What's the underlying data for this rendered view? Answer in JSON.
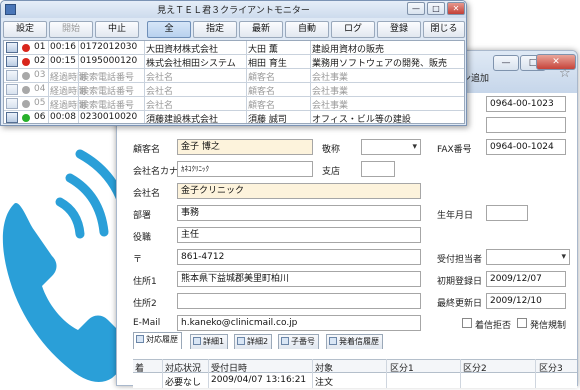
{
  "monitor": {
    "title": "見えＴＥＬ君３クライアントモニター",
    "controls": {
      "minimize": "—",
      "maximize": "□",
      "close": "✕"
    },
    "toolbar": [
      {
        "label": "設定",
        "state": "normal"
      },
      {
        "label": "開始",
        "state": "disabled"
      },
      {
        "label": "中止",
        "state": "normal"
      },
      {
        "label": "全",
        "state": "pressed"
      },
      {
        "label": "指定",
        "state": "normal"
      },
      {
        "label": "最新",
        "state": "normal"
      },
      {
        "label": "自動",
        "state": "normal"
      },
      {
        "label": "ログ",
        "state": "normal"
      },
      {
        "label": "登録",
        "state": "normal"
      },
      {
        "label": "閉じる",
        "state": "normal"
      }
    ],
    "rows": [
      {
        "num": "01",
        "time": "00:16",
        "phone": "0172012030",
        "company": "大田資材株式会社",
        "person": "大田 薫",
        "business": "建設用資材の販売",
        "status": "red",
        "active": true
      },
      {
        "num": "02",
        "time": "00:15",
        "phone": "0195000120",
        "company": "株式会社相田システム",
        "person": "相田 育生",
        "business": "業務用ソフトウェアの開発、販売",
        "status": "red",
        "active": true
      },
      {
        "num": "03",
        "time": "経過時間",
        "phone": "検索電話番号",
        "company": "会社名",
        "person": "顧客名",
        "business": "会社事業",
        "status": "gray",
        "active": false
      },
      {
        "num": "04",
        "time": "経過時間",
        "phone": "検索電話番号",
        "company": "会社名",
        "person": "顧客名",
        "business": "会社事業",
        "status": "gray",
        "active": false
      },
      {
        "num": "05",
        "time": "経過時間",
        "phone": "検索電話番号",
        "company": "会社名",
        "person": "顧客名",
        "business": "会社事業",
        "status": "gray",
        "active": false
      },
      {
        "num": "06",
        "time": "00:08",
        "phone": "0230010020",
        "company": "須藤建設株式会社",
        "person": "須藤 誠司",
        "business": "オフィス・ビル等の建設",
        "status": "green",
        "active": true
      }
    ],
    "status_colors": {
      "red": "#d8261c",
      "green": "#27b02b",
      "gray": "#a8a8a8"
    }
  },
  "customer": {
    "header_label": "ョン追加",
    "fields": {
      "customer_name_label": "顧客名",
      "customer_name": "金子 博之",
      "honorific_label": "敬称",
      "honorific": "",
      "company_kana_label": "会社名カナ",
      "company_kana": "ｶﾈｺｸﾘﾆｯｸ",
      "branch_label": "支店",
      "branch": "",
      "company_label": "会社名",
      "company": "金子クリニック",
      "dept_label": "部署",
      "dept": "事務",
      "title_label": "役職",
      "title": "主任",
      "zip_label": "〒",
      "zip": "861-4712",
      "address1_label": "住所1",
      "address1": "熊本県下益城郡美里町柏川",
      "address2_label": "住所2",
      "address2": "",
      "email_label": "E-Mail",
      "email": "h.kaneko@clinicmail.co.jp",
      "phone1": "0964-00-1023",
      "phone2": "",
      "fax_label": "FAX番号",
      "fax": "0964-00-1024",
      "birthday_label": "生年月日",
      "birthday": "",
      "receiver_label": "受付担当者",
      "receiver": "",
      "first_reg_label": "初期登録日",
      "first_reg": "2009/12/07",
      "last_update_label": "最終更新日",
      "last_update": "2009/12/10",
      "reject_incoming_label": "着信拒否",
      "outgoing_rule_label": "発信規制"
    },
    "tabs": [
      "対応履歴",
      "詳細1",
      "詳細2",
      "子番号",
      "発着信履歴"
    ],
    "history_columns": [
      "着",
      "対応状況",
      "受付日時",
      "対象",
      "区分1",
      "区分2",
      "区分3"
    ],
    "history_rows": [
      {
        "flag": "",
        "status": "必要なし",
        "datetime": "2009/04/07 13:16:21",
        "target": "注文",
        "cat1": "",
        "cat2": "",
        "cat3": ""
      }
    ]
  }
}
